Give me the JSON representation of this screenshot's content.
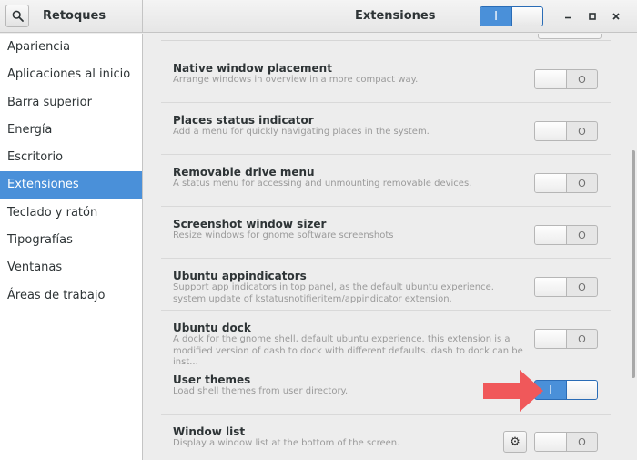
{
  "header": {
    "app_title": "Retoques",
    "page_title": "Extensiones",
    "master_switch_on_label": "I",
    "window_controls": {
      "minimize_icon": "minimize-icon",
      "maximize_icon": "maximize-icon",
      "close_icon": "close-icon"
    },
    "search_icon": "search-icon"
  },
  "sidebar": {
    "items": [
      {
        "label": "Apariencia",
        "active": false
      },
      {
        "label": "Aplicaciones al inicio",
        "active": false
      },
      {
        "label": "Barra superior",
        "active": false
      },
      {
        "label": "Energía",
        "active": false
      },
      {
        "label": "Escritorio",
        "active": false
      },
      {
        "label": "Extensiones",
        "active": true
      },
      {
        "label": "Teclado y ratón",
        "active": false
      },
      {
        "label": "Tipografías",
        "active": false
      },
      {
        "label": "Ventanas",
        "active": false
      },
      {
        "label": "Áreas de trabajo",
        "active": false
      }
    ]
  },
  "extensions": [
    {
      "name": "Native window placement",
      "description": "Arrange windows in overview in a more compact way.",
      "enabled": false,
      "off_label": "O"
    },
    {
      "name": "Places status indicator",
      "description": "Add a menu for quickly navigating places in the system.",
      "enabled": false,
      "off_label": "O"
    },
    {
      "name": "Removable drive menu",
      "description": "A status menu for accessing and unmounting removable devices.",
      "enabled": false,
      "off_label": "O"
    },
    {
      "name": "Screenshot window sizer",
      "description": "Resize windows for gnome software screenshots",
      "enabled": false,
      "off_label": "O"
    },
    {
      "name": "Ubuntu appindicators",
      "description": "Support app indicators in top panel, as the default ubuntu experience. system update of kstatusnotifieritem/appindicator extension.",
      "enabled": false,
      "off_label": "O"
    },
    {
      "name": "Ubuntu dock",
      "description": "A dock for the gnome shell, default ubuntu experience. this extension is a modified version of dash to dock with different defaults. dash to dock can be inst...",
      "enabled": false,
      "off_label": "O"
    },
    {
      "name": "User themes",
      "description": "Load shell themes from user directory.",
      "enabled": true,
      "on_label": "I"
    },
    {
      "name": "Window list",
      "description": "Display a window list at the bottom of the screen.",
      "enabled": false,
      "off_label": "O",
      "has_settings": true
    }
  ],
  "colors": {
    "accent": "#4a90d9",
    "arrow": "#f0585a"
  }
}
